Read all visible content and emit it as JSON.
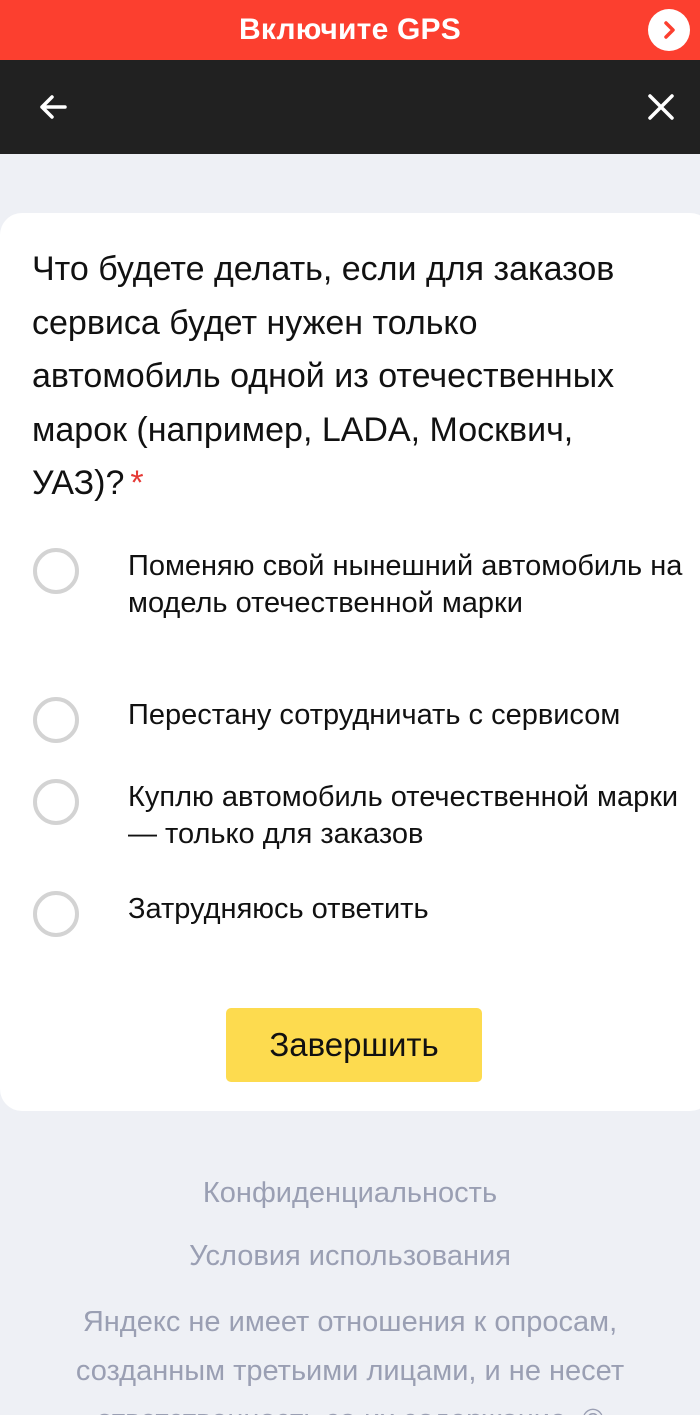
{
  "gps_banner": {
    "title": "Включите GPS",
    "icon": "chevron-right-icon",
    "background": "#fc3f2f"
  },
  "toolbar": {
    "back_icon": "arrow-left-icon",
    "close_icon": "close-icon",
    "background": "#212121"
  },
  "question": {
    "text": "Что будете делать, если для заказов сервиса будет нужен только автомобиль одной из отечественных марок (например, LADA, Москвич, УАЗ)?",
    "required_mark": "*"
  },
  "options": [
    {
      "label": "Поменяю свой нынешний автомобиль на модель отечественной марки",
      "selected": false
    },
    {
      "label": "Перестану сотрудничать с сервисом",
      "selected": false
    },
    {
      "label": "Куплю автомобиль отечественной марки — только для заказов",
      "selected": false
    },
    {
      "label": "Затрудняюсь ответить",
      "selected": false
    }
  ],
  "submit": {
    "label": "Завершить",
    "color": "#fddb4f"
  },
  "footer": {
    "privacy": "Конфиденциальность",
    "terms": "Условия использования",
    "disclaimer": "Яндекс не имеет отношения к опросам, созданным третьими лицами, и не несет ответственность за их содержание. ©"
  }
}
